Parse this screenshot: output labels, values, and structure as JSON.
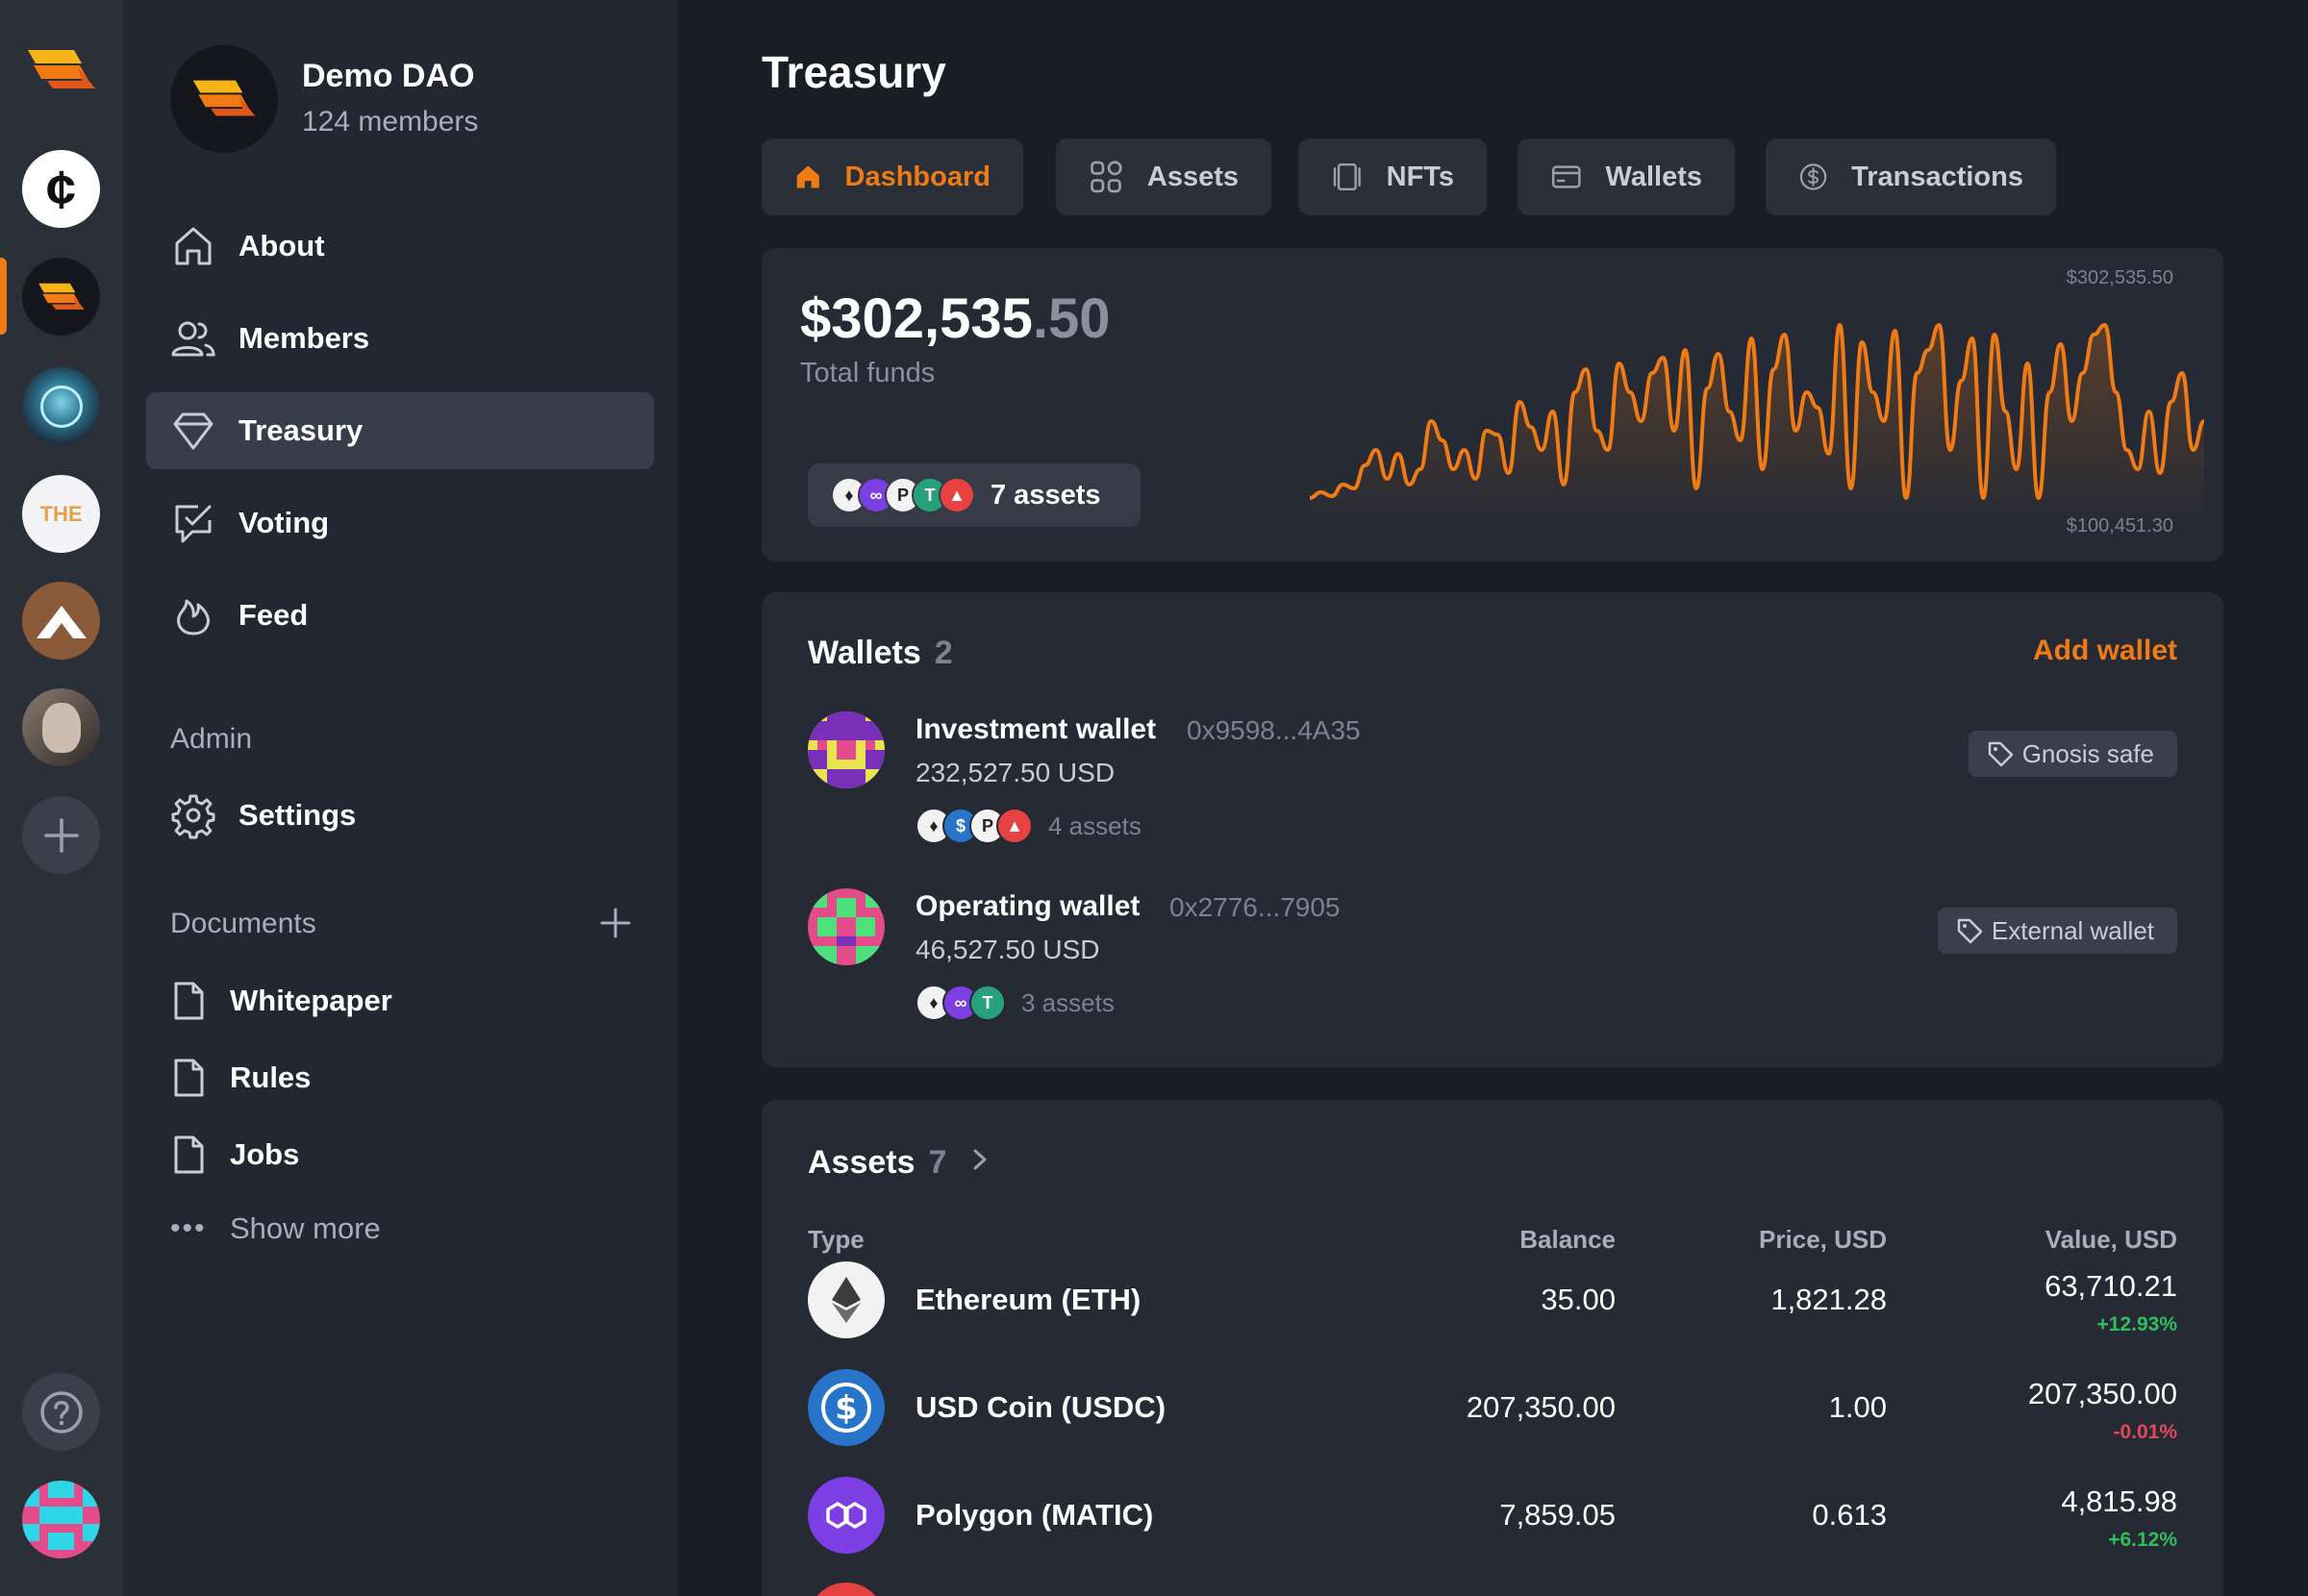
{
  "rail": {
    "items": [
      {
        "name": "dao-logo-main",
        "label": ""
      },
      {
        "name": "dao-cent",
        "label": "¢"
      },
      {
        "name": "dao-demo",
        "label": ""
      },
      {
        "name": "dao-globe",
        "label": ""
      },
      {
        "name": "dao-the",
        "label": "THE"
      },
      {
        "name": "dao-mountain",
        "label": ""
      },
      {
        "name": "dao-face",
        "label": ""
      }
    ],
    "add_label": "+",
    "help_label": "?"
  },
  "sidebar": {
    "dao_name": "Demo DAO",
    "members": "124 members",
    "nav": [
      {
        "label": "About",
        "icon": "home-icon"
      },
      {
        "label": "Members",
        "icon": "users-icon"
      },
      {
        "label": "Treasury",
        "icon": "diamond-icon"
      },
      {
        "label": "Voting",
        "icon": "vote-icon"
      },
      {
        "label": "Feed",
        "icon": "flame-icon"
      }
    ],
    "admin_label": "Admin",
    "settings_label": "Settings",
    "documents_label": "Documents",
    "documents": [
      "Whitepaper",
      "Rules",
      "Jobs"
    ],
    "show_more": "Show more"
  },
  "main": {
    "title": "Treasury",
    "tabs": [
      {
        "label": "Dashboard",
        "icon": "home-icon",
        "active": true
      },
      {
        "label": "Assets",
        "icon": "grid-icon",
        "active": false
      },
      {
        "label": "NFTs",
        "icon": "nft-icon",
        "active": false
      },
      {
        "label": "Wallets",
        "icon": "wallet-icon",
        "active": false
      },
      {
        "label": "Transactions",
        "icon": "dollar-icon",
        "active": false
      }
    ],
    "funds": {
      "whole": "$302,535",
      "cents": ".50",
      "label": "Total funds",
      "assets_count": "7 assets",
      "chart_max": "$302,535.50",
      "chart_min": "$100,451.30"
    },
    "wallets": {
      "title": "Wallets",
      "count": "2",
      "add_label": "Add wallet",
      "items": [
        {
          "name": "Investment wallet",
          "address": "0x9598...4A35",
          "usd": "232,527.50 USD",
          "assets": "4 assets",
          "tag": "Gnosis safe"
        },
        {
          "name": "Operating wallet",
          "address": "0x2776...7905",
          "usd": "46,527.50 USD",
          "assets": "3 assets",
          "tag": "External wallet"
        }
      ]
    },
    "assets": {
      "title": "Assets",
      "count": "7",
      "headers": {
        "type": "Type",
        "balance": "Balance",
        "price": "Price, USD",
        "value": "Value, USD"
      },
      "rows": [
        {
          "name": "Ethereum (ETH)",
          "balance": "35.00",
          "price": "1,821.28",
          "value": "63,710.21",
          "change": "+12.93%"
        },
        {
          "name": "USD Coin (USDC)",
          "balance": "207,350.00",
          "price": "1.00",
          "value": "207,350.00",
          "change": "-0.01%"
        },
        {
          "name": "Polygon (MATIC)",
          "balance": "7,859.05",
          "price": "0.613",
          "value": "4,815.98",
          "change": "+6.12%"
        }
      ]
    }
  },
  "colors": {
    "accent": "#f07b15",
    "positive": "#2fbf5a",
    "negative": "#e5475a"
  }
}
